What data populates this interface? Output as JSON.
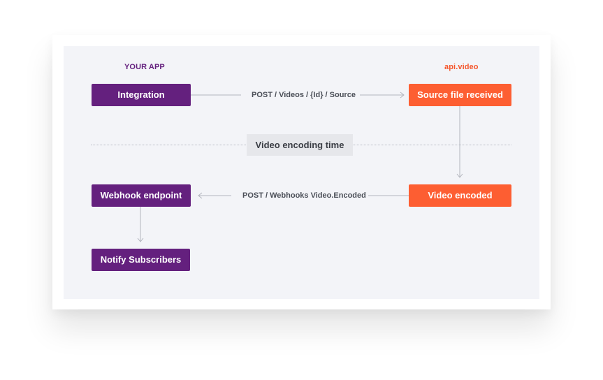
{
  "headings": {
    "your_app": "YOUR APP",
    "api_video": "api.video"
  },
  "nodes": {
    "integration": "Integration",
    "source_file_received": "Source file received",
    "video_encoded": "Video encoded",
    "webhook_endpoint": "Webhook endpoint",
    "notify_subscribers": "Notify Subscribers"
  },
  "edges": {
    "post_source": "POST / Videos / {Id} / Source",
    "post_webhook": "POST / Webhooks Video.Encoded"
  },
  "divider": {
    "label": "Video encoding time"
  },
  "colors": {
    "app_purple": "#64207e",
    "api_orange": "#fd5e32",
    "panel_bg": "#f3f4f8"
  }
}
